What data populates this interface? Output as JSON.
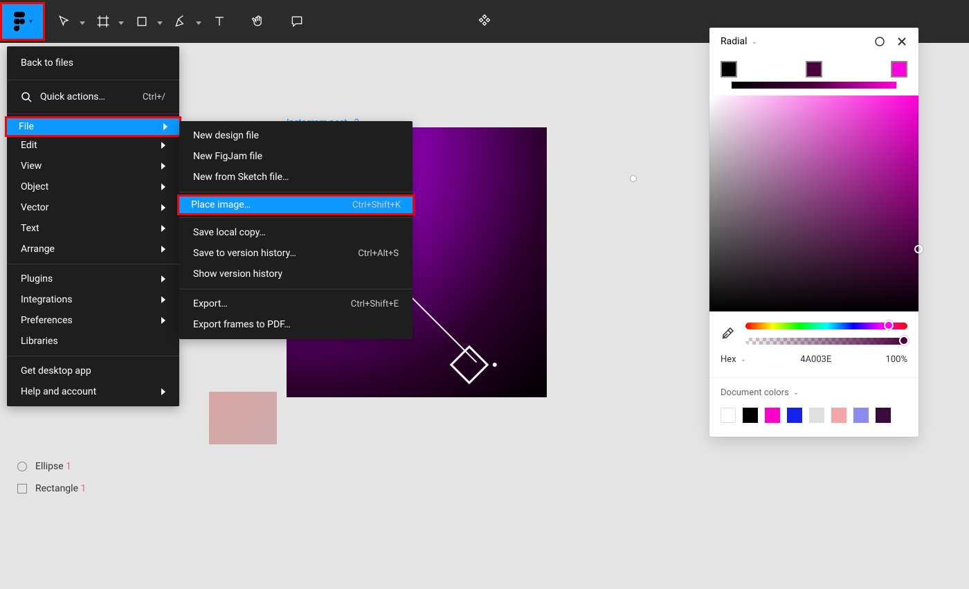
{
  "toolbar": {
    "app": "Figma"
  },
  "menu": {
    "back": "Back to files",
    "quick": "Quick actions…",
    "quick_sc": "Ctrl+/",
    "file": "File",
    "edit": "Edit",
    "view": "View",
    "object": "Object",
    "vector": "Vector",
    "text": "Text",
    "arrange": "Arrange",
    "plugins": "Plugins",
    "integrations": "Integrations",
    "preferences": "Preferences",
    "libraries": "Libraries",
    "get_desktop": "Get desktop app",
    "help": "Help and account"
  },
  "submenu": {
    "new_design": "New design file",
    "new_figjam": "New FigJam file",
    "new_sketch": "New from Sketch file…",
    "place_image": "Place image…",
    "place_image_sc": "Ctrl+Shift+K",
    "save_local": "Save local copy…",
    "save_version": "Save to version history…",
    "save_version_sc": "Ctrl+Alt+S",
    "show_version": "Show version history",
    "export": "Export…",
    "export_sc": "Ctrl+Shift+E",
    "export_pdf": "Export frames to PDF…"
  },
  "canvas": {
    "frame_label": "Instagram post - 2"
  },
  "layers": {
    "ellipse": "Ellipse ",
    "ellipse_num": "1",
    "rectangle": "Rectangle ",
    "rectangle_num": "1"
  },
  "colorpanel": {
    "type": "Radial",
    "hex_label": "Hex",
    "hex_value": "4A003E",
    "opacity": "100%",
    "doc_colors": "Document colors",
    "stops": [
      "#000000",
      "#4A003E",
      "#FF00DD"
    ],
    "swatches": [
      "#FFFFFF",
      "#000000",
      "#FF00CC",
      "#1522EE",
      "#E0E0E0",
      "#F5A6A6",
      "#8A8AF0",
      "#3A0A3A"
    ]
  }
}
